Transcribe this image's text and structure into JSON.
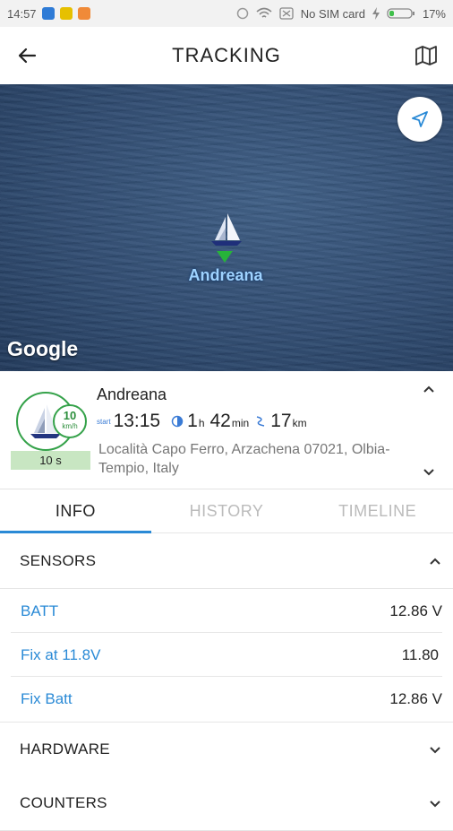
{
  "status_bar": {
    "time": "14:57",
    "carrier": "No SIM card",
    "battery": "17%"
  },
  "app_bar": {
    "title": "TRACKING",
    "back_icon": "arrow-left-icon",
    "map_icon": "map-icon"
  },
  "map": {
    "vessel_label": "Andreana",
    "attribution": "Google",
    "locate_icon": "navigation-arrow-icon"
  },
  "vehicle": {
    "name": "Andreana",
    "speed_value": "10",
    "speed_unit": "km/h",
    "update_age": "10 s",
    "start_prefix": "start",
    "start_time": "13:15",
    "duration_hours": "1",
    "duration_hours_unit": "h",
    "duration_minutes": "42",
    "duration_minutes_unit": "min",
    "distance_value": "17",
    "distance_unit": "km",
    "address": "Località Capo Ferro, Arzachena 07021, Olbia-Tempio, Italy"
  },
  "tabs": [
    {
      "label": "INFO",
      "active": true
    },
    {
      "label": "HISTORY",
      "active": false
    },
    {
      "label": "TIMELINE",
      "active": false
    }
  ],
  "sensors": {
    "title": "SENSORS",
    "expanded": true,
    "items": [
      {
        "label": "BATT",
        "value": "12.86 V"
      },
      {
        "label": "Fix at 11.8V",
        "value": "11.80"
      },
      {
        "label": "Fix Batt",
        "value": "12.86 V"
      }
    ]
  },
  "hardware": {
    "title": "HARDWARE",
    "expanded": false
  },
  "counters": {
    "title": "COUNTERS",
    "expanded": false
  },
  "colors": {
    "accent": "#2a8ad6",
    "online_green": "#35a24a"
  }
}
